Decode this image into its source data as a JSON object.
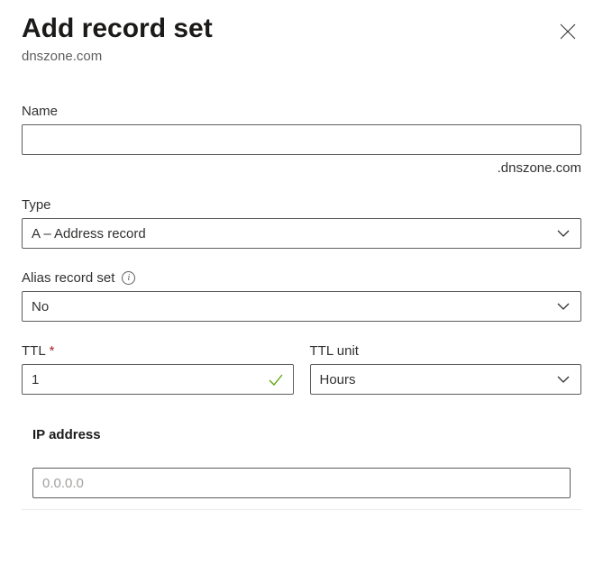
{
  "header": {
    "title": "Add record set",
    "subtitle": "dnszone.com"
  },
  "fields": {
    "name": {
      "label": "Name",
      "value": "",
      "suffix": ".dnszone.com"
    },
    "type": {
      "label": "Type",
      "value": "A – Address record"
    },
    "alias": {
      "label": "Alias record set",
      "value": "No"
    },
    "ttl": {
      "label": "TTL",
      "value": "1"
    },
    "ttlUnit": {
      "label": "TTL unit",
      "value": "Hours"
    },
    "ipAddress": {
      "label": "IP address",
      "placeholder": "0.0.0.0"
    }
  }
}
